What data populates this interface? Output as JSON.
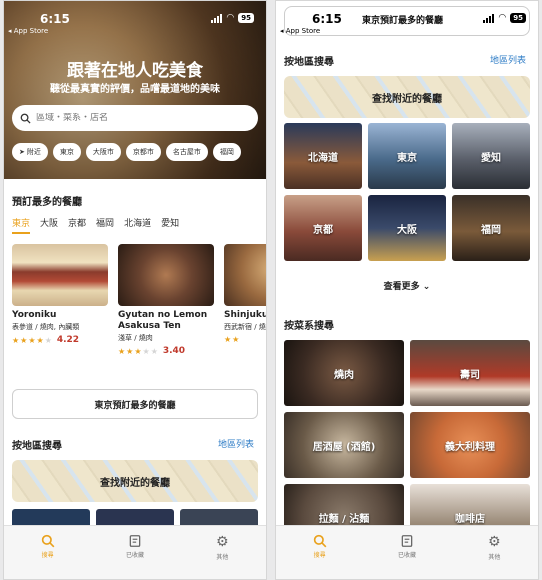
{
  "status": {
    "time": "6:15",
    "back_label": "◂ App Store",
    "battery": "95"
  },
  "home": {
    "hero_title": "跟著在地人吃美食",
    "hero_subtitle": "聽從最真實的評價，品嚐最道地的美味",
    "search_placeholder": "區域・菜系・店名",
    "chips": [
      "附近",
      "東京",
      "大阪市",
      "京都市",
      "名古屋市",
      "福岡"
    ],
    "top_section_title": "預訂最多的餐廳",
    "city_tabs": [
      "東京",
      "大阪",
      "京都",
      "福岡",
      "北海道",
      "愛知"
    ],
    "restaurants": [
      {
        "name": "Yoroniku",
        "location": "表參道 / 燒肉, 內臟類",
        "stars": 4,
        "rating": "4.22",
        "img_color": "#8a3b2c"
      },
      {
        "name": "Gyutan no Lemon Asakusa Ten",
        "location": "淺草 / 燒肉",
        "stars": 3,
        "rating": "3.40",
        "img_color": "#5a3a28"
      },
      {
        "name": "Shinjuku Gyutan",
        "location": "西武新宿 / 燒肉, 內臟類",
        "stars": 2,
        "rating": "",
        "img_color": "#7a5a3a"
      }
    ],
    "more_button": "東京預訂最多的餐廳",
    "region_section_title": "按地區搜尋",
    "map_link": "地區列表",
    "nearby_button": "查找附近的餐廳"
  },
  "detail": {
    "header_title": "東京預訂最多的餐廳",
    "region_section_title": "按地區搜尋",
    "map_link": "地區列表",
    "nearby_button": "查找附近的餐廳",
    "regions": [
      {
        "label": "北海道",
        "color": "#6b4a3a"
      },
      {
        "label": "東京",
        "color": "#4a6a8a"
      },
      {
        "label": "愛知",
        "color": "#5a5f6a"
      },
      {
        "label": "京都",
        "color": "#8a5a4a"
      },
      {
        "label": "大阪",
        "color": "#3a4a6a"
      },
      {
        "label": "福岡",
        "color": "#5a4a3a"
      }
    ],
    "see_more": "查看更多",
    "cuisine_section_title": "按菜系搜尋",
    "cuisines": [
      {
        "label": "燒肉",
        "color": "#3a2a22"
      },
      {
        "label": "壽司",
        "color": "#b03a28"
      },
      {
        "label": "居酒屋 (酒館)",
        "color": "#6a5a48"
      },
      {
        "label": "義大利料理",
        "color": "#c86a38"
      },
      {
        "label": "拉麵 / 沾麵",
        "color": "#5a4a3e"
      },
      {
        "label": "咖啡店",
        "color": "#9a8a78"
      }
    ]
  },
  "tabbar": {
    "items": [
      {
        "label": "搜尋",
        "icon": "search-icon"
      },
      {
        "label": "已收藏",
        "icon": "bookmark-icon"
      },
      {
        "label": "其他",
        "icon": "gear-icon"
      }
    ]
  },
  "colors": {
    "accent": "#e9a11c",
    "link": "#2e7cc6",
    "rating": "#c0392b"
  }
}
